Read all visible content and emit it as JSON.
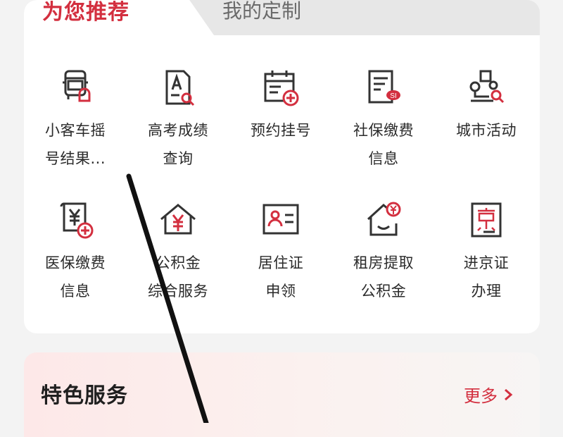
{
  "tabs": {
    "active": "为您推荐",
    "inactive": "我的定制"
  },
  "services": [
    {
      "label": "小客车摇\n号结果...",
      "icon": "car-lottery-icon"
    },
    {
      "label": "高考成绩\n查询",
      "icon": "exam-score-icon"
    },
    {
      "label": "预约挂号",
      "icon": "calendar-add-icon"
    },
    {
      "label": "社保缴费\n信息",
      "icon": "social-security-icon"
    },
    {
      "label": "城市活动",
      "icon": "city-activity-icon"
    },
    {
      "label": "医保缴费\n信息",
      "icon": "medical-insurance-icon"
    },
    {
      "label": "公积金\n综合服务",
      "icon": "housing-fund-icon"
    },
    {
      "label": "居住证\n申领",
      "icon": "residence-permit-icon"
    },
    {
      "label": "租房提取\n公积金",
      "icon": "rent-withdraw-icon"
    },
    {
      "label": "进京证\n办理",
      "icon": "beijing-pass-icon"
    }
  ],
  "feature": {
    "title": "特色服务",
    "more": "更多"
  },
  "colors": {
    "accent": "#d32f3f",
    "text": "#2b2b2b",
    "icon_dark": "#333333"
  }
}
